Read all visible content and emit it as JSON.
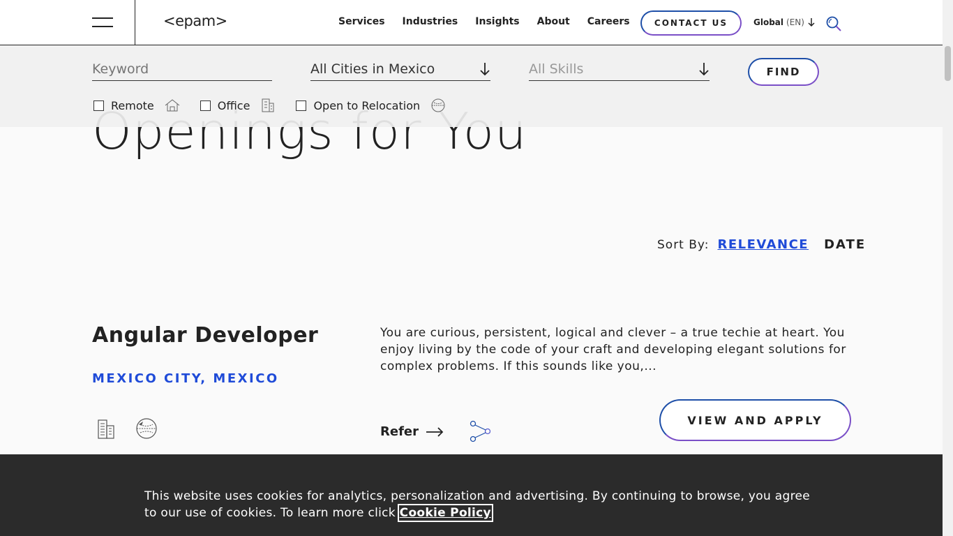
{
  "header": {
    "logo": "<epam>",
    "nav": [
      "Services",
      "Industries",
      "Insights",
      "About",
      "Careers"
    ],
    "contact_label": "CONTACT US",
    "lang_label": "Global",
    "lang_code": "(EN)"
  },
  "filters": {
    "keyword_placeholder": "Keyword",
    "city_value": "All Cities in Mexico",
    "skills_value": "All Skills",
    "find_label": "FIND",
    "checkboxes": [
      {
        "label": "Remote",
        "checked": false
      },
      {
        "label": "Office",
        "checked": false
      },
      {
        "label": "Open to Relocation",
        "checked": false
      }
    ]
  },
  "hero": {
    "line2": "Openings for You"
  },
  "sort": {
    "label": "Sort By:",
    "relevance": "RELEVANCE",
    "date": "DATE"
  },
  "job": {
    "title": "Angular Developer",
    "location": "MEXICO CITY, MEXICO",
    "description": "You are curious, persistent, logical and clever – a true techie at heart. You enjoy living by the code of your craft and developing elegant solutions for complex problems. If this sounds like you,...",
    "refer_label": "Refer",
    "apply_label": "VIEW AND APPLY"
  },
  "cookie": {
    "text": "This website uses cookies for analytics, personalization and advertising. By continuing to browse, you agree to our use of cookies. To learn more click ",
    "link": "Cookie Policy"
  }
}
